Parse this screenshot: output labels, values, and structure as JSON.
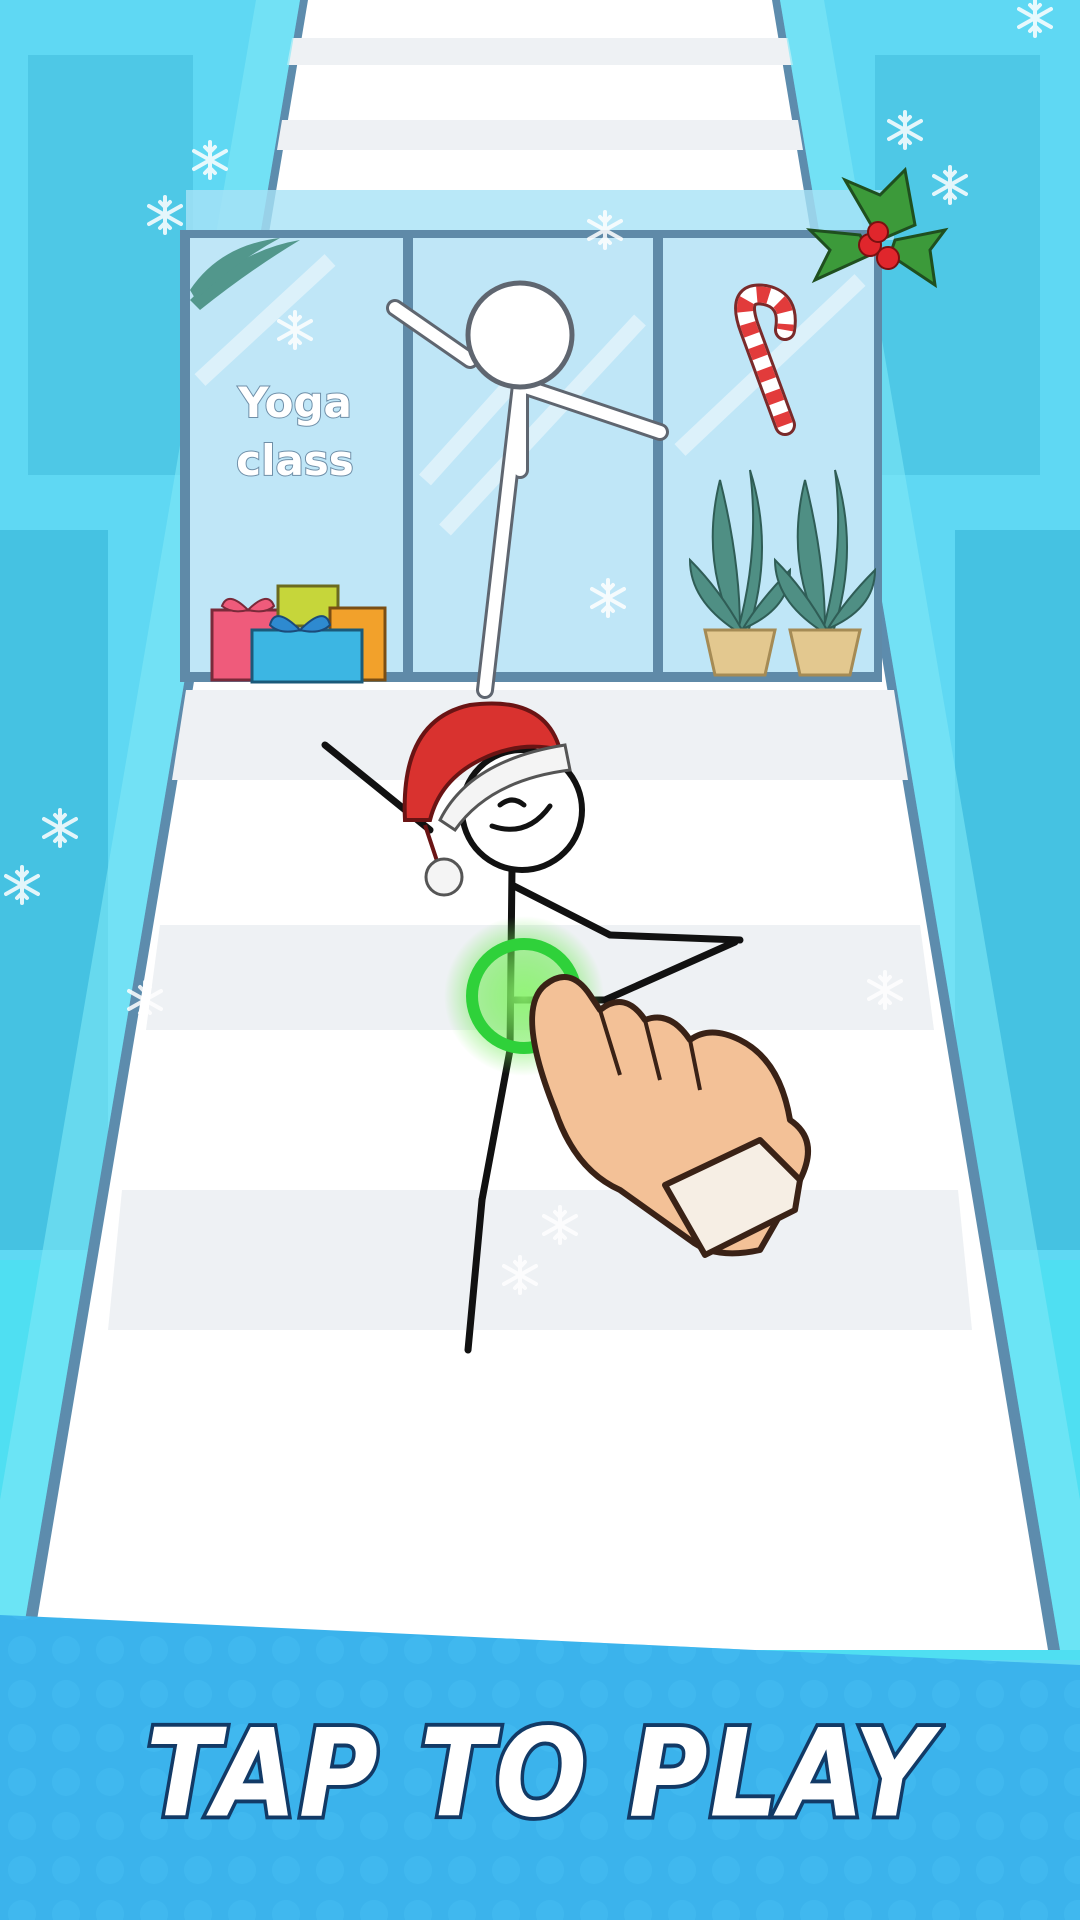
{
  "window_sign": {
    "line1": "Yoga",
    "line2": "class"
  },
  "cta": {
    "label": "TAP TO PLAY"
  },
  "icons": [
    "snowflake-icon",
    "holly-icon",
    "candy-cane-icon",
    "gift-boxes-icon",
    "potted-plant-icon",
    "santa-hat-icon",
    "tap-hand-icon",
    "tap-target-ring-icon"
  ],
  "colors": {
    "wall": "#5fd8f3",
    "floor": "#ffffff",
    "floor_stripe": "#eef1f4",
    "window_glass": "#bfe6f7",
    "window_frame": "#5f8aa8",
    "footer_band": "#3bb3ec",
    "tap_ring": "#2fd13a",
    "santa_hat": "#d9322f",
    "hand_skin": "#f3c197"
  }
}
